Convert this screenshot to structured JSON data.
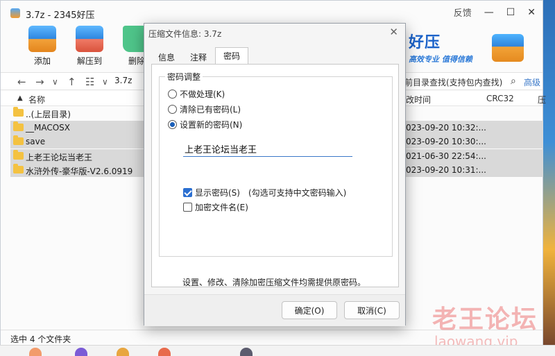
{
  "app": {
    "title": "3.7z - 2345好压",
    "feedback": "反馈",
    "minimize": "—",
    "maximize": "☐",
    "close": "✕"
  },
  "toolbar": {
    "add": "添加",
    "extract": "解压到",
    "delete": "删除"
  },
  "brand": {
    "name": "好压",
    "slogan": "高效专业 值得信赖"
  },
  "addressbar": {
    "back": "←",
    "forward": "→",
    "dropdown": "∨",
    "up": "↑",
    "view": "☷",
    "path": "3.7z",
    "search_fragment": "前目录查找(支持包内查找)",
    "advanced": "高级"
  },
  "columns": {
    "name": "名称",
    "modified": "改时间",
    "crc": "CRC32",
    "extra": "压"
  },
  "files": [
    {
      "name": "..(上层目录)",
      "time": "",
      "selected": false
    },
    {
      "name": "__MACOSX",
      "time": "023-09-20 10:32:...",
      "selected": true
    },
    {
      "name": "save",
      "time": "023-09-20 10:30:...",
      "selected": true
    },
    {
      "name": "上老王论坛当老王",
      "time": "021-06-30 22:54:...",
      "selected": true
    },
    {
      "name": "水浒外传-豪华版-V2.6.0919",
      "time": "023-09-20 10:31:...",
      "selected": true
    }
  ],
  "status": "选中 4 个文件夹",
  "watermark": {
    "line1": "老王论坛",
    "line2": "laowang.vip"
  },
  "dialog": {
    "title": "压缩文件信息: 3.7z",
    "close": "✕",
    "tabs": [
      "信息",
      "注释",
      "密码"
    ],
    "active_tab": "密码",
    "group_title": "密码调整",
    "options": [
      {
        "label": "不做处理(K)",
        "checked": false
      },
      {
        "label": "清除已有密码(L)",
        "checked": false
      },
      {
        "label": "设置新的密码(N)",
        "checked": true
      }
    ],
    "password_value": "上老王论坛当老王",
    "show_password": {
      "label": "显示密码(S)",
      "hint": "(勾选可支持中文密码输入)",
      "checked": true
    },
    "encrypt_names": {
      "label": "加密文件名(E)",
      "checked": false
    },
    "note": "设置、修改、清除加密压缩文件均需提供原密码。",
    "ok": "确定(O)",
    "cancel": "取消(C)"
  }
}
